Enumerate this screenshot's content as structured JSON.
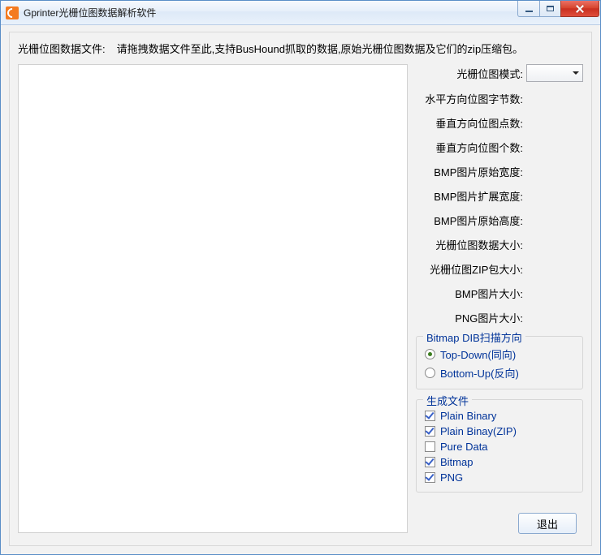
{
  "window": {
    "title": "Gprinter光栅位图数据解析软件"
  },
  "topRow": {
    "label": "光栅位图数据文件:",
    "hint": "请拖拽数据文件至此,支持BusHound抓取的数据,原始光栅位图数据及它们的zip压缩包。"
  },
  "params": [
    {
      "label": "光栅位图模式:",
      "value": ""
    },
    {
      "label": "水平方向位图字节数:",
      "value": ""
    },
    {
      "label": "垂直方向位图点数:",
      "value": ""
    },
    {
      "label": "垂直方向位图个数:",
      "value": ""
    },
    {
      "label": "BMP图片原始宽度:",
      "value": ""
    },
    {
      "label": "BMP图片扩展宽度:",
      "value": ""
    },
    {
      "label": "BMP图片原始高度:",
      "value": ""
    },
    {
      "label": "光栅位图数据大小:",
      "value": ""
    },
    {
      "label": "光栅位图ZIP包大小:",
      "value": ""
    },
    {
      "label": "BMP图片大小:",
      "value": ""
    },
    {
      "label": "PNG图片大小:",
      "value": ""
    }
  ],
  "scanDirection": {
    "legend": "Bitmap DIB扫描方向",
    "options": [
      {
        "label": "Top-Down(同向)",
        "checked": true
      },
      {
        "label": "Bottom-Up(反向)",
        "checked": false
      }
    ]
  },
  "generateFiles": {
    "legend": "生成文件",
    "options": [
      {
        "label": "Plain Binary",
        "checked": true
      },
      {
        "label": "Plain Binay(ZIP)",
        "checked": true
      },
      {
        "label": "Pure Data",
        "checked": false
      },
      {
        "label": "Bitmap",
        "checked": true
      },
      {
        "label": "PNG",
        "checked": true
      }
    ]
  },
  "buttons": {
    "exit": "退出"
  }
}
